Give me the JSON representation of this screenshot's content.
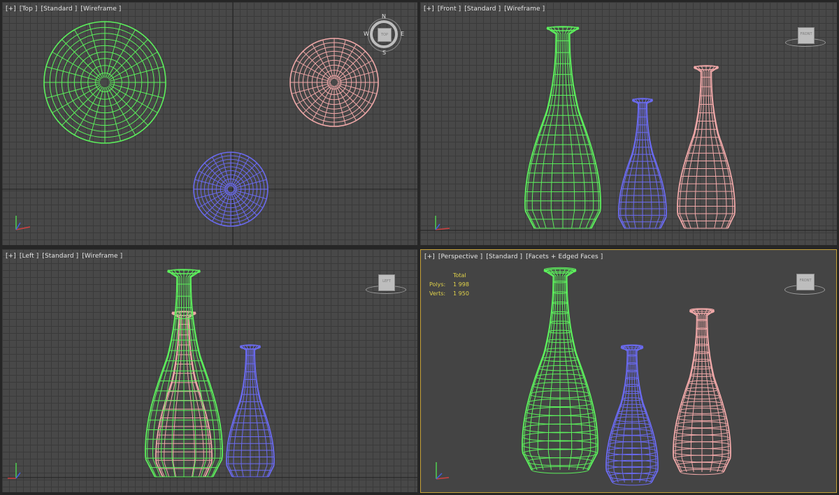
{
  "viewports": {
    "top": {
      "plus": "[+]",
      "view": "[Top ]",
      "shading": "[Standard ]",
      "mode": "[Wireframe ]"
    },
    "front": {
      "plus": "[+]",
      "view": "[Front ]",
      "shading": "[Standard ]",
      "mode": "[Wireframe ]"
    },
    "left": {
      "plus": "[+]",
      "view": "[Left ]",
      "shading": "[Standard ]",
      "mode": "[Wireframe ]"
    },
    "perspective": {
      "plus": "[+]",
      "view": "[Perspective ]",
      "shading": "[Standard ]",
      "mode": "[Facets + Edged Faces ]"
    }
  },
  "stats": {
    "header": "Total",
    "polys_label": "Polys:",
    "polys_value": "1 998",
    "verts_label": "Verts:",
    "verts_value": "1 950"
  },
  "compass": {
    "n": "N",
    "s": "S",
    "e": "E",
    "w": "W",
    "face": "TOP"
  },
  "cube_faces": {
    "front": "FRONT",
    "left": "LEFT",
    "persp": "FRONT"
  },
  "colors": {
    "green": "#5cf05c",
    "pink": "#f0a8a8",
    "blue": "#6a6af0",
    "grid": "#484848",
    "active_border": "#c8a43a"
  },
  "objects": [
    "green-vase",
    "blue-vase",
    "pink-vase"
  ]
}
